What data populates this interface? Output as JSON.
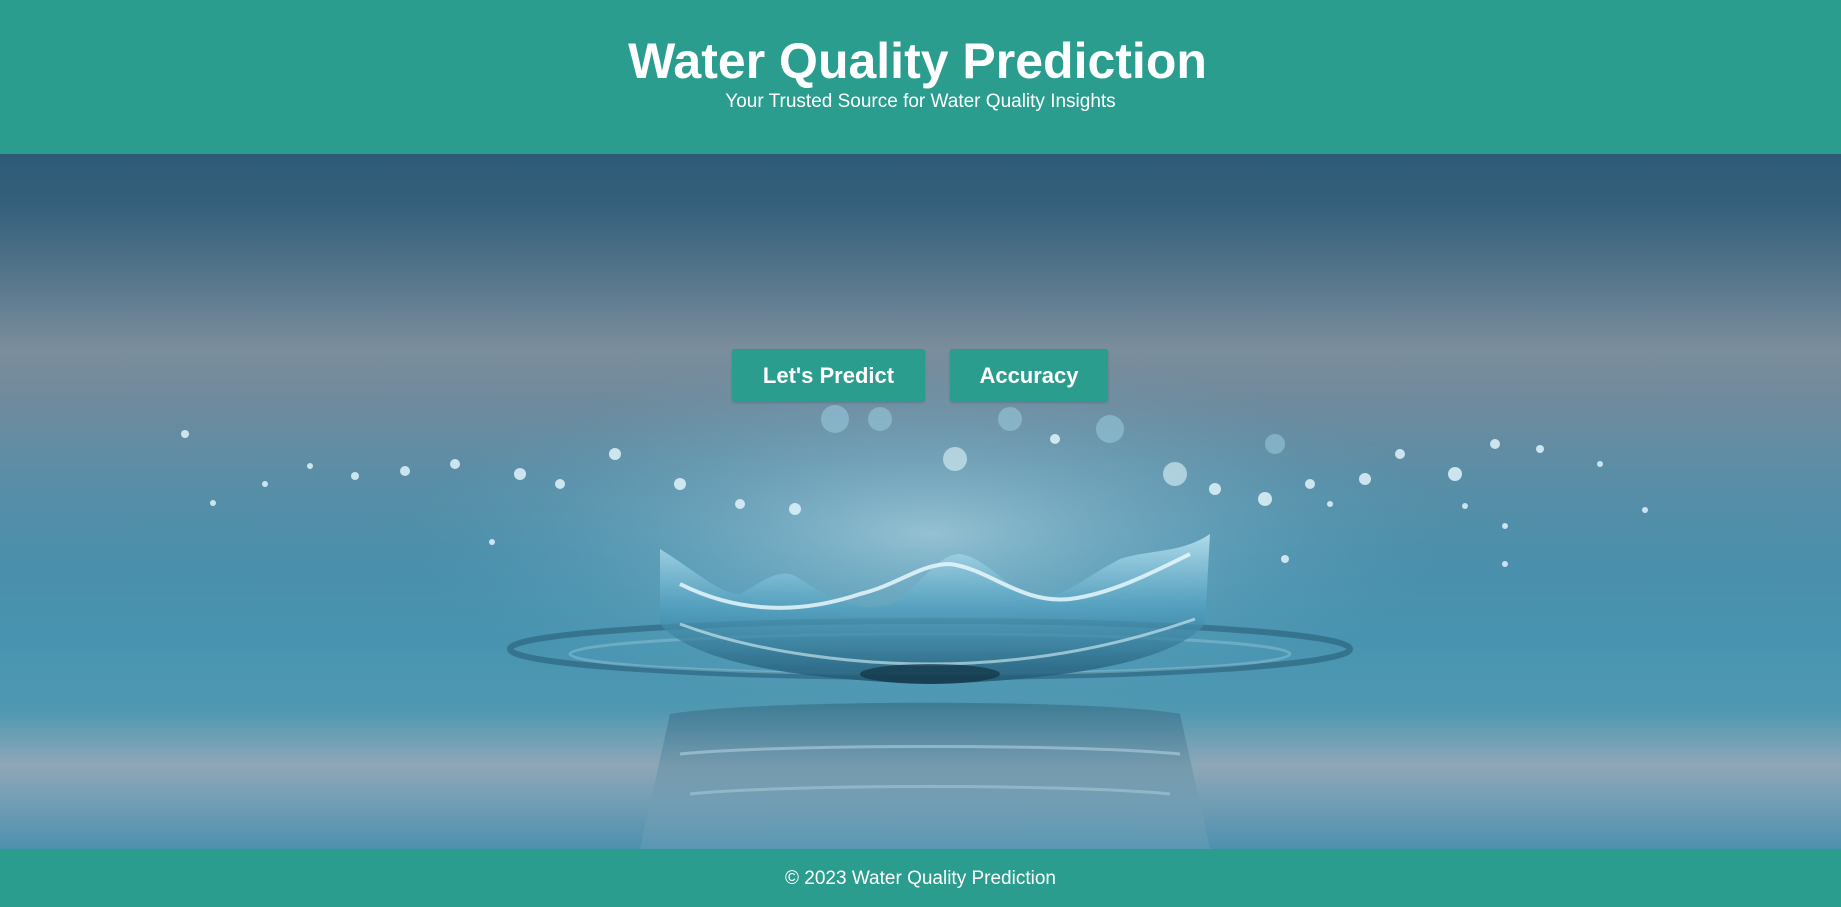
{
  "header": {
    "title": "Water Quality Prediction",
    "subtitle": "Your Trusted Source for Water Quality Insights"
  },
  "actions": {
    "predict_label": "Let's Predict",
    "accuracy_label": "Accuracy"
  },
  "footer": {
    "copyright": "© 2023 Water Quality Prediction"
  },
  "colors": {
    "brand": "#2a9d8f",
    "text_on_brand": "#ffffff"
  },
  "hero": {
    "image": "water-splash-crown"
  }
}
